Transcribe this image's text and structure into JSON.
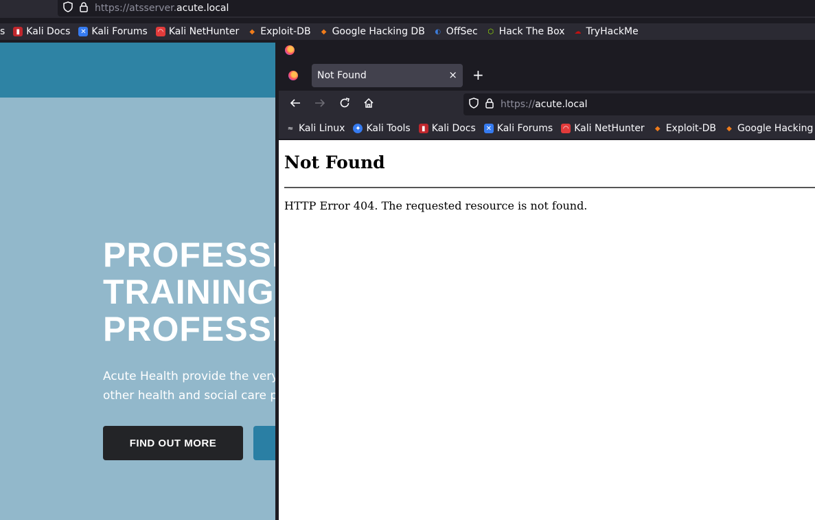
{
  "back_window": {
    "url_prefix": "https://atsserver.",
    "url_domain": "acute.local",
    "bookmarks": [
      {
        "label": "s",
        "icon": "partial"
      },
      {
        "label": "Kali Docs",
        "icon": "kali-docs-icon"
      },
      {
        "label": "Kali Forums",
        "icon": "kali-forums-icon"
      },
      {
        "label": "Kali NetHunter",
        "icon": "kali-nethunter-icon"
      },
      {
        "label": "Exploit-DB",
        "icon": "exploit-db-icon"
      },
      {
        "label": "Google Hacking DB",
        "icon": "ghdb-icon"
      },
      {
        "label": "OffSec",
        "icon": "offsec-icon"
      },
      {
        "label": "Hack The Box",
        "icon": "htb-icon"
      },
      {
        "label": "TryHackMe",
        "icon": "tryhackme-icon"
      }
    ],
    "hero": {
      "line1": "PROFESSI",
      "line2": "TRAINING",
      "line3": "PROFESSI",
      "subtitle_line1": "Acute Health provide the very",
      "subtitle_line2": "other health and social care p",
      "button_label": "FIND OUT MORE"
    }
  },
  "front_window": {
    "tab_title": "Not Found",
    "new_tab": "+",
    "close_tab": "×",
    "url_prefix": "https://",
    "url_domain": "acute.local",
    "bookmarks": [
      {
        "label": "Kali Linux",
        "icon": "kali-linux-icon"
      },
      {
        "label": "Kali Tools",
        "icon": "kali-tools-icon"
      },
      {
        "label": "Kali Docs",
        "icon": "kali-docs-icon"
      },
      {
        "label": "Kali Forums",
        "icon": "kali-forums-icon"
      },
      {
        "label": "Kali NetHunter",
        "icon": "kali-nethunter-icon"
      },
      {
        "label": "Exploit-DB",
        "icon": "exploit-db-icon"
      },
      {
        "label": "Google Hacking DB",
        "icon": "ghdb-icon"
      }
    ],
    "page": {
      "heading": "Not Found",
      "message": "HTTP Error 404. The requested resource is not found."
    }
  },
  "colors": {
    "back_header": "#2e83a4",
    "back_page": "#92b8cb",
    "button_dark": "#232427",
    "toolbar": "#2b2a33",
    "tab_active": "#42414d"
  }
}
